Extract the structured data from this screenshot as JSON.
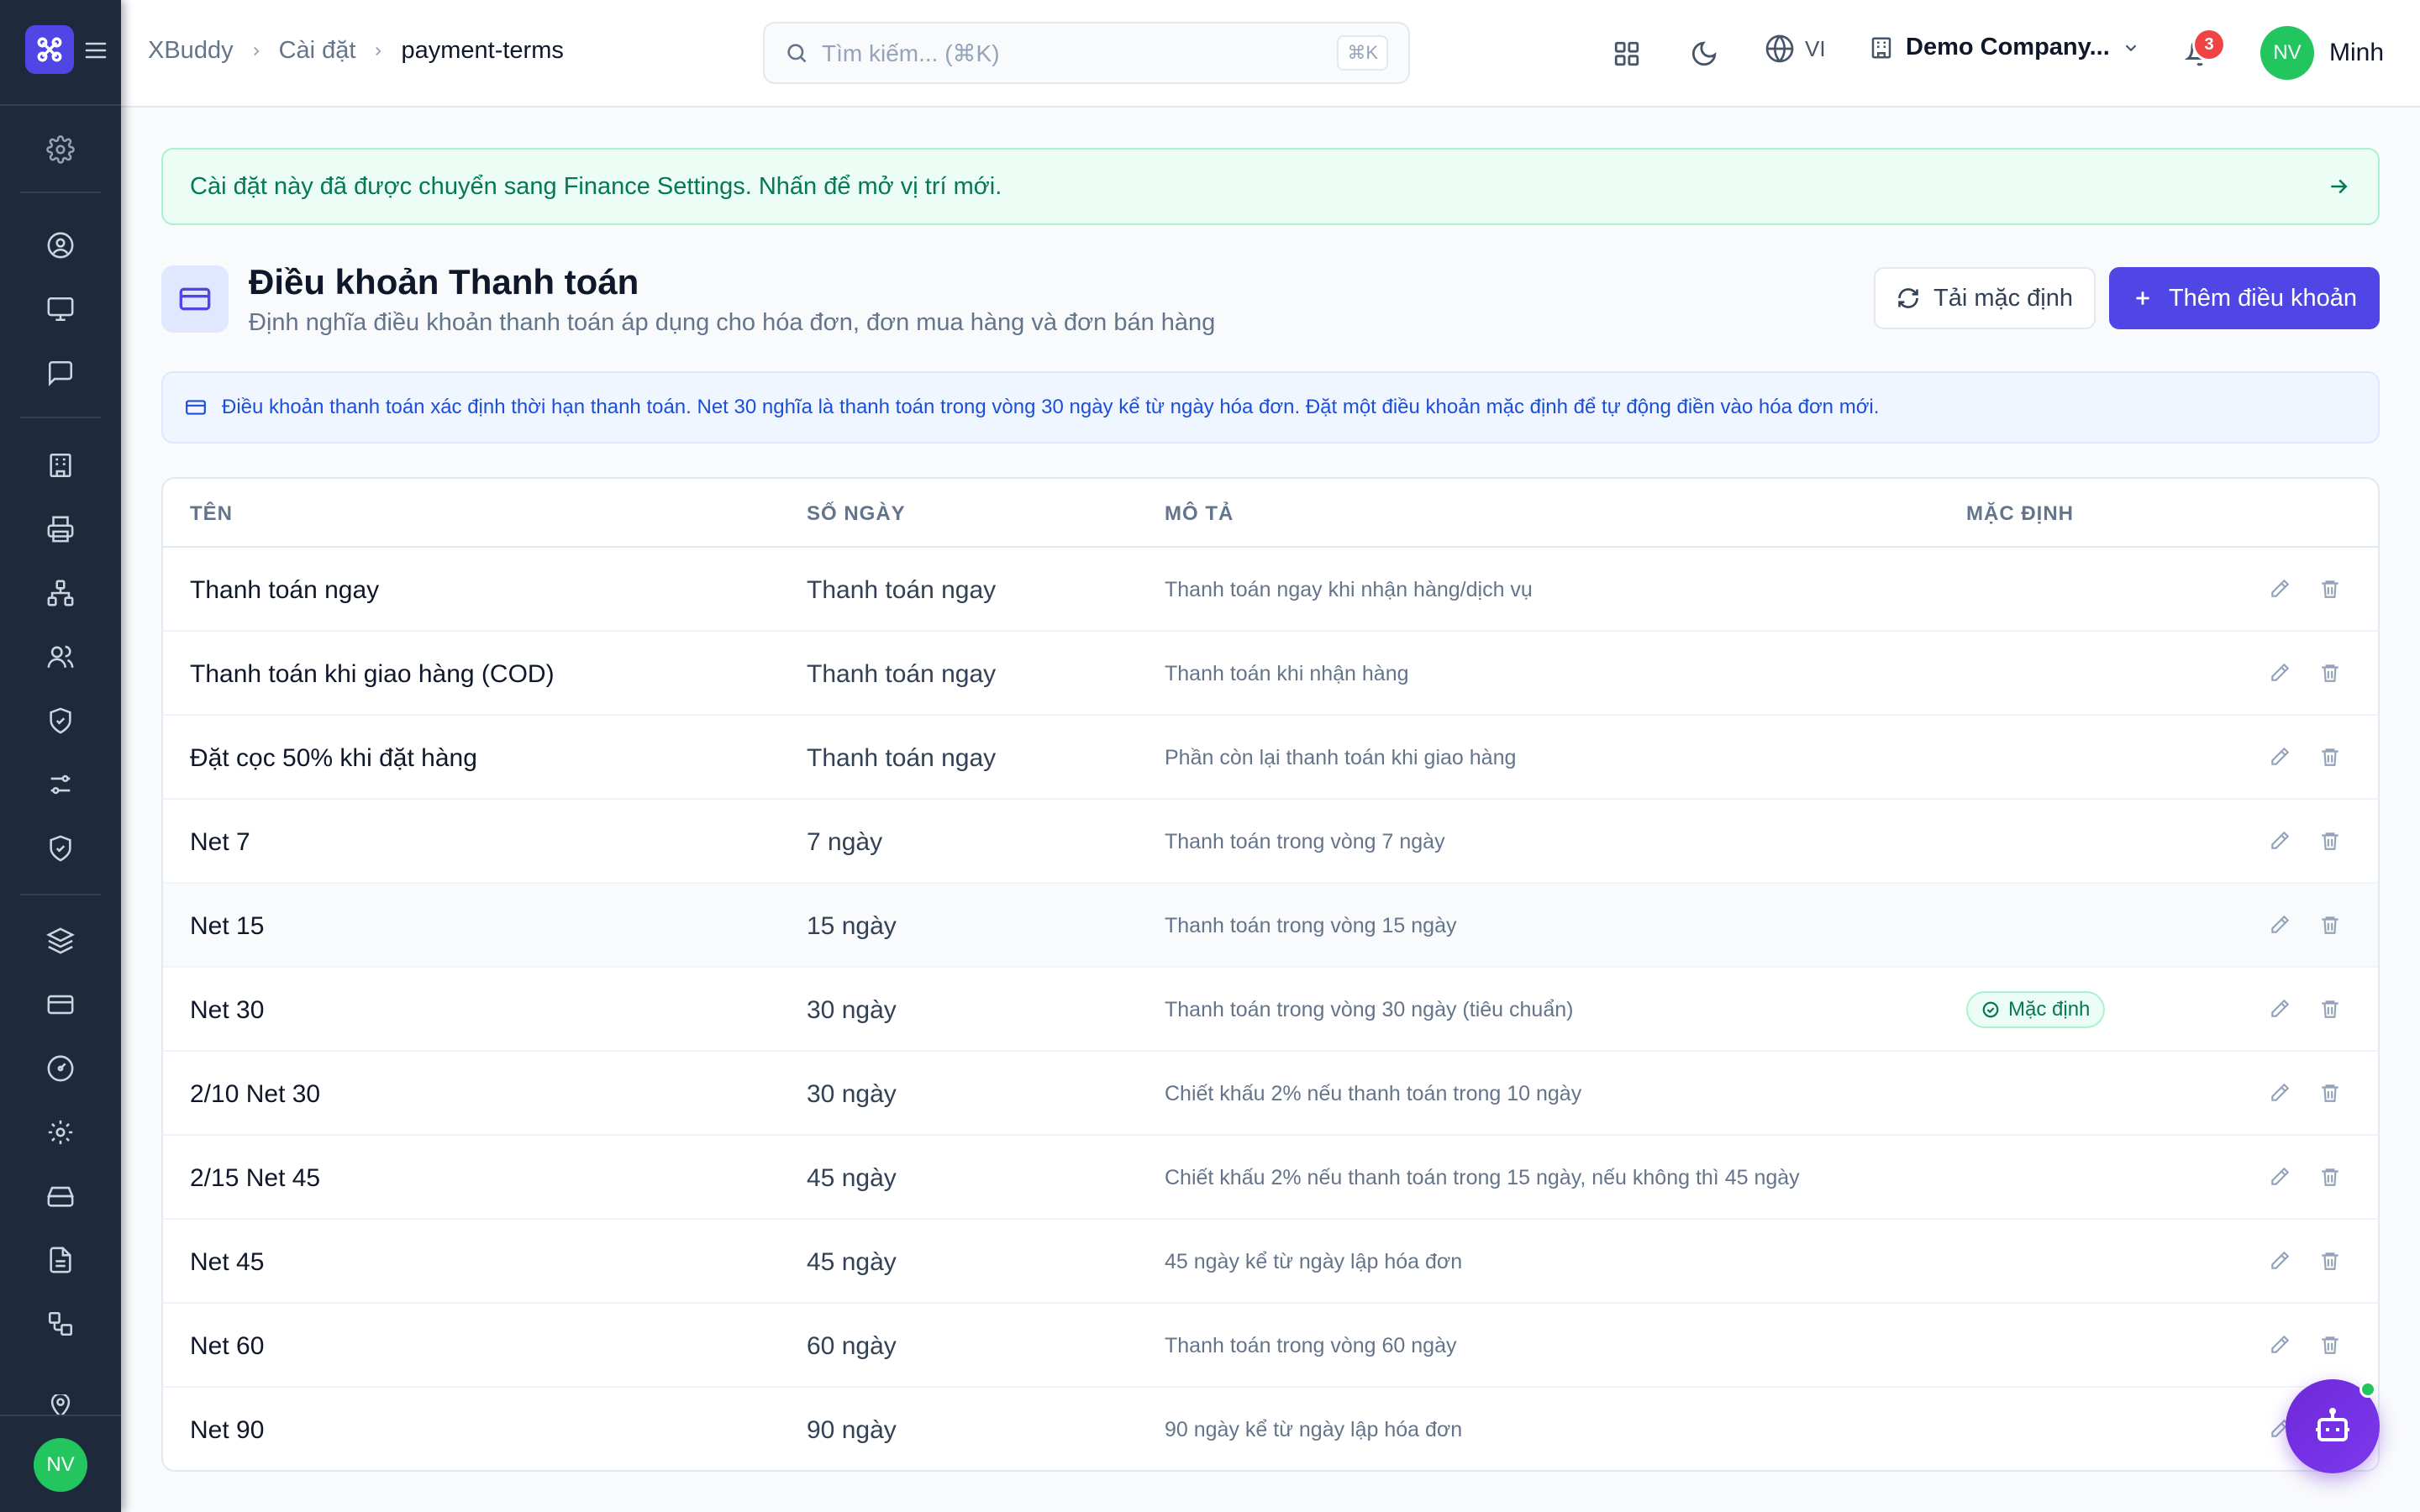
{
  "app": {
    "logo_icon": "app-logo-icon",
    "menu_icon": "hamburger-icon"
  },
  "sidebar": {
    "items": [
      {
        "icon": "settings-icon"
      },
      {
        "icon": "user-circle-icon"
      },
      {
        "icon": "monitor-icon"
      },
      {
        "icon": "message-square-icon"
      },
      {
        "icon": "building-icon"
      },
      {
        "icon": "printer-icon"
      },
      {
        "icon": "network-icon"
      },
      {
        "icon": "users-icon"
      },
      {
        "icon": "shield-check-icon"
      },
      {
        "icon": "sliders-icon"
      },
      {
        "icon": "shield-check-icon"
      },
      {
        "icon": "layers-icon"
      },
      {
        "icon": "credit-card-icon"
      },
      {
        "icon": "gauge-icon"
      },
      {
        "icon": "gear-icon"
      },
      {
        "icon": "hard-drive-icon"
      },
      {
        "icon": "file-text-icon"
      },
      {
        "icon": "workflow-icon"
      }
    ],
    "avatar_initials": "NV"
  },
  "header": {
    "breadcrumb": [
      "XBuddy",
      "Cài đặt",
      "payment-terms"
    ],
    "search": {
      "placeholder": "Tìm kiếm... (⌘K)",
      "shortcut": "⌘K"
    },
    "language": "VI",
    "company": "Demo Company...",
    "notification_count": "3",
    "user": {
      "initials": "NV",
      "name": "Minh"
    }
  },
  "notice": {
    "text": "Cài đặt này đã được chuyển sang Finance Settings. Nhấn để mở vị trí mới."
  },
  "page": {
    "title": "Điều khoản Thanh toán",
    "subtitle": "Định nghĩa điều khoản thanh toán áp dụng cho hóa đơn, đơn mua hàng và đơn bán hàng",
    "reset_label": "Tải mặc định",
    "add_label": "Thêm điều khoản",
    "info": "Điều khoản thanh toán xác định thời hạn thanh toán. Net 30 nghĩa là thanh toán trong vòng 30 ngày kể từ ngày hóa đơn. Đặt một điều khoản mặc định để tự động điền vào hóa đơn mới."
  },
  "table": {
    "columns": [
      "TÊN",
      "SỐ NGÀY",
      "MÔ TẢ",
      "MẶC ĐỊNH"
    ],
    "default_badge": "Mặc định",
    "rows": [
      {
        "name": "Thanh toán ngay",
        "days": "Thanh toán ngay",
        "desc": "Thanh toán ngay khi nhận hàng/dịch vụ",
        "is_default": false
      },
      {
        "name": "Thanh toán khi giao hàng (COD)",
        "days": "Thanh toán ngay",
        "desc": "Thanh toán khi nhận hàng",
        "is_default": false
      },
      {
        "name": "Đặt cọc 50% khi đặt hàng",
        "days": "Thanh toán ngay",
        "desc": "Phần còn lại thanh toán khi giao hàng",
        "is_default": false
      },
      {
        "name": "Net 7",
        "days": "7 ngày",
        "desc": "Thanh toán trong vòng 7 ngày",
        "is_default": false
      },
      {
        "name": "Net 15",
        "days": "15 ngày",
        "desc": "Thanh toán trong vòng 15 ngày",
        "is_default": false
      },
      {
        "name": "Net 30",
        "days": "30 ngày",
        "desc": "Thanh toán trong vòng 30 ngày (tiêu chuẩn)",
        "is_default": true
      },
      {
        "name": "2/10 Net 30",
        "days": "30 ngày",
        "desc": "Chiết khấu 2% nếu thanh toán trong 10 ngày",
        "is_default": false
      },
      {
        "name": "2/15 Net 45",
        "days": "45 ngày",
        "desc": "Chiết khấu 2% nếu thanh toán trong 15 ngày, nếu không thì 45 ngày",
        "is_default": false
      },
      {
        "name": "Net 45",
        "days": "45 ngày",
        "desc": "45 ngày kể từ ngày lập hóa đơn",
        "is_default": false
      },
      {
        "name": "Net 60",
        "days": "60 ngày",
        "desc": "Thanh toán trong vòng 60 ngày",
        "is_default": false
      },
      {
        "name": "Net 90",
        "days": "90 ngày",
        "desc": "90 ngày kể từ ngày lập hóa đơn",
        "is_default": false
      }
    ]
  },
  "colors": {
    "primary": "#4f46e5",
    "sidebar_bg": "#1e293b",
    "success": "#047857",
    "info": "#1d4ed8",
    "danger": "#ef4444",
    "assistant": "#7c3aed"
  },
  "assistant": {
    "icon": "bot-icon"
  }
}
